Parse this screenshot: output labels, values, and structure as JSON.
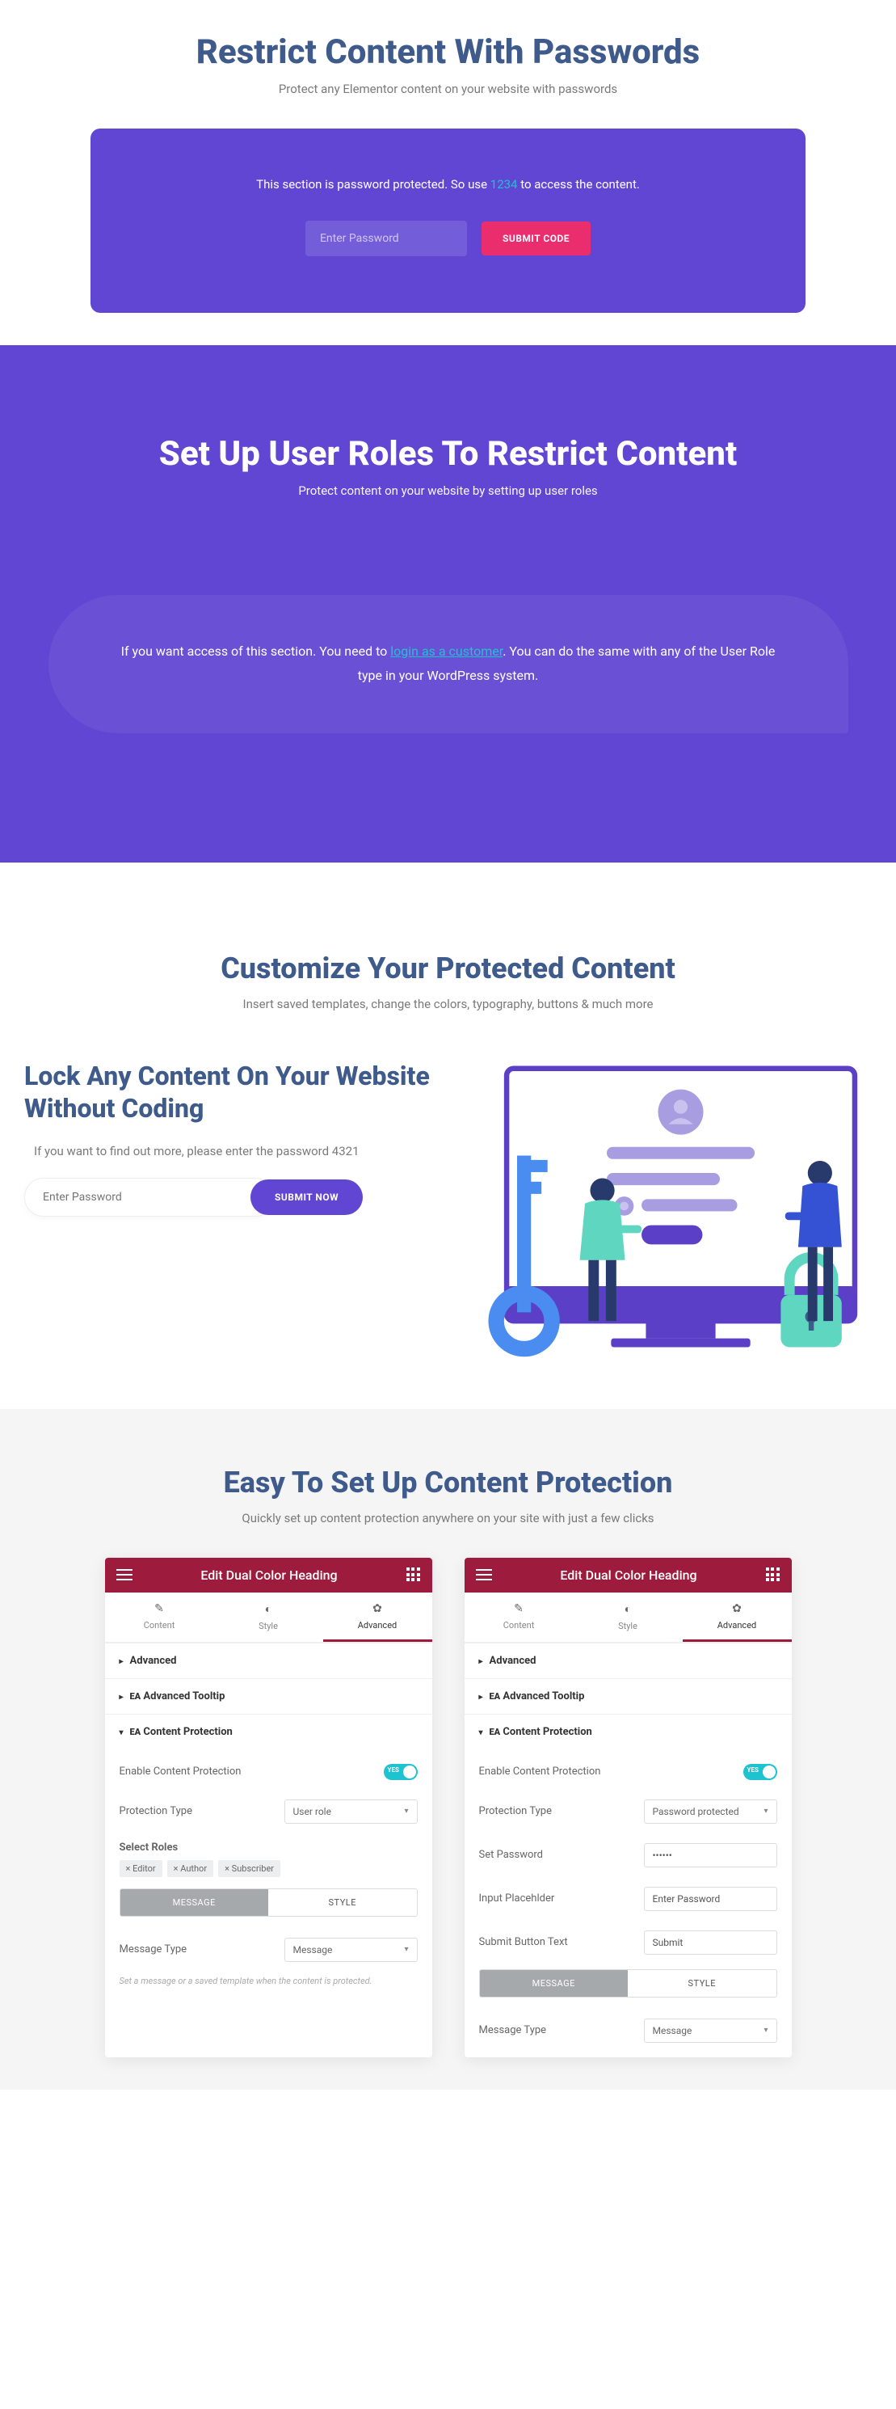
{
  "hero1": {
    "title": "Restrict Content With Passwords",
    "subtitle": "Protect any Elementor content on your website with passwords",
    "msg_pre": "This section is password protected. So use ",
    "code": "1234",
    "msg_post": " to access the content.",
    "placeholder": "Enter Password",
    "btn": "SUBMIT CODE"
  },
  "hero2": {
    "title": "Set Up User Roles To Restrict Content",
    "subtitle": "Protect content on your website by setting up user roles",
    "msg_pre": "If you want access of this section. You need to ",
    "link": "login as a customer",
    "msg_post": ". You can do the same with any of the User Role type in your WordPress system."
  },
  "hero3": {
    "title": "Customize Your Protected Content",
    "subtitle": "Insert saved templates, change the colors, typography, buttons & much more",
    "left_title": "Lock Any Content On Your Website Without Coding",
    "left_sub": "If you want to find out more, please enter the password 4321",
    "placeholder": "Enter Password",
    "btn": "SUBMIT NOW"
  },
  "hero4": {
    "title": "Easy To Set Up Content Protection",
    "subtitle": "Quickly set up content protection anywhere on your site with just a few clicks"
  },
  "panel": {
    "top": "Edit Dual Color Heading",
    "tabs": [
      "Content",
      "Style",
      "Advanced"
    ],
    "rows": [
      "Advanced",
      "Advanced Tooltip",
      "Content Protection"
    ],
    "f_enable": "Enable Content Protection",
    "f_toggle": "YES",
    "f_type": "Protection Type",
    "v_type_role": "User role",
    "v_type_pw": "Password protected",
    "f_roles": "Select Roles",
    "chips": [
      "× Editor",
      "× Author",
      "× Subscriber"
    ],
    "seg": [
      "MESSAGE",
      "STYLE"
    ],
    "f_msgtype": "Message Type",
    "v_msgtype": "Message",
    "hint": "Set a message or a saved template when the content is protected.",
    "f_setpw": "Set Password",
    "v_setpw": "••••••",
    "f_ph": "Input Placehlder",
    "v_ph": "Enter Password",
    "f_sbt": "Submit Button Text",
    "v_sbt": "Submit"
  }
}
